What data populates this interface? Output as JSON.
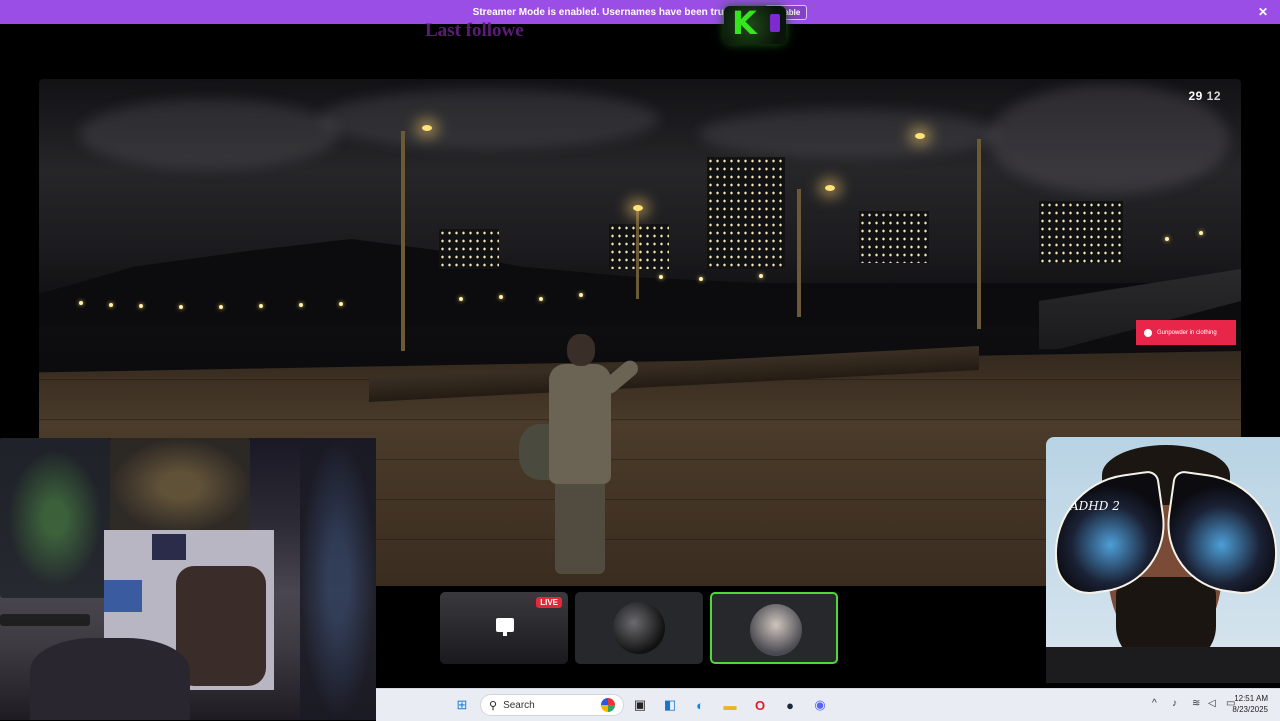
{
  "banner": {
    "message": "Streamer Mode is enabled. Usernames have been truncated.",
    "action_label": "Disable",
    "close_label": "✕"
  },
  "overlay": {
    "last_follower_text": "Last followe",
    "logo_letter": "K"
  },
  "game": {
    "hud_time_hours": "29",
    "hud_time_minutes": "12",
    "notification": "Gunpowder in clothing"
  },
  "thumbnails": {
    "live_badge": "LIVE",
    "items": [
      "screen-share",
      "participant-2",
      "participant-3"
    ],
    "active_index": 2
  },
  "art": {
    "text": "ADHD 2"
  },
  "taskbar": {
    "search_placeholder": "Search",
    "time": "12:51 AM",
    "date": "8/23/2025",
    "icons": [
      "windows-start",
      "search",
      "task-view",
      "widgets",
      "edge",
      "file-explorer",
      "opera",
      "steam",
      "discord"
    ],
    "tray_icons": [
      "chevron-up",
      "microphone",
      "wifi",
      "volume",
      "battery"
    ]
  },
  "colors": {
    "banner": "#9a4ee6",
    "active_border": "#4fd83a",
    "live": "#e02a3c",
    "toast": "#e7264a"
  }
}
